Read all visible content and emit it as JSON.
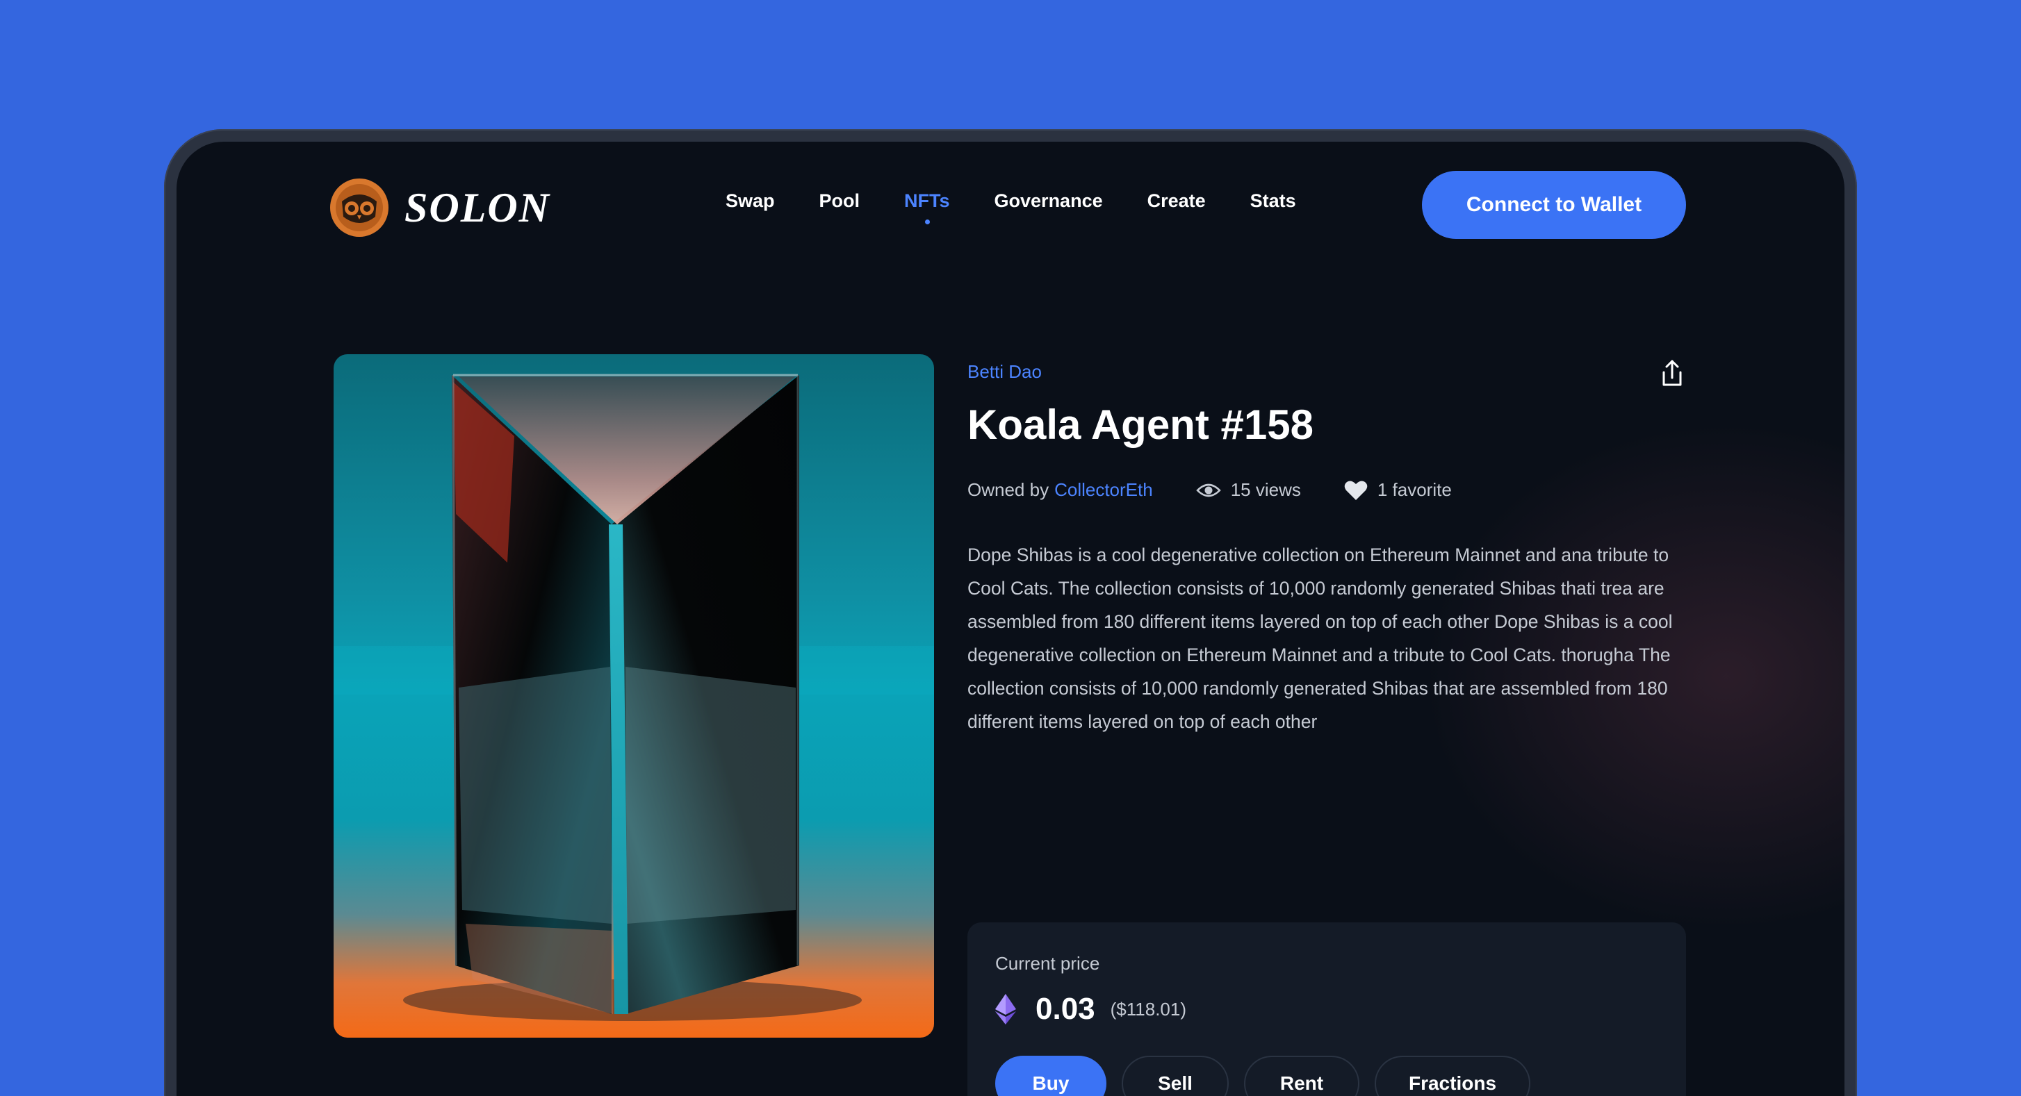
{
  "brand": {
    "name": "SOLON",
    "accent": "#3b73f5",
    "link_color": "#4c84ff",
    "logo_color": "#d9782d"
  },
  "nav": {
    "links": [
      {
        "label": "Swap",
        "active": false
      },
      {
        "label": "Pool",
        "active": false
      },
      {
        "label": "NFTs",
        "active": true
      },
      {
        "label": "Governance",
        "active": false
      },
      {
        "label": "Create",
        "active": false
      },
      {
        "label": "Stats",
        "active": false
      }
    ],
    "connect_label": "Connect to Wallet"
  },
  "nft": {
    "collection": "Betti Dao",
    "title": "Koala Agent #158",
    "owned_by_label": "Owned by",
    "owner": "CollectorEth",
    "views": "15 views",
    "favorites": "1 favorite",
    "description": "Dope Shibas is a cool degenerative collection on Ethereum Mainnet and ana tribute to Cool Cats. The collection consists of 10,000 randomly generated Shibas thati trea are assembled from 180 different items layered on top of each other Dope Shibas is a cool degenerative collection on Ethereum Mainnet and a tribute to Cool Cats. thorugha The collection consists of 10,000 randomly generated Shibas that are assembled from 180 different items layered on top of each other",
    "icons": {
      "views": "eye-icon",
      "favorites": "heart-icon",
      "share": "share-icon",
      "currency": "ethereum-icon"
    }
  },
  "price": {
    "label": "Current price",
    "value": "0.03",
    "usd": "($118.01)"
  },
  "actions": {
    "buy": "Buy",
    "sell": "Sell",
    "rent": "Rent",
    "fractions": "Fractions"
  }
}
